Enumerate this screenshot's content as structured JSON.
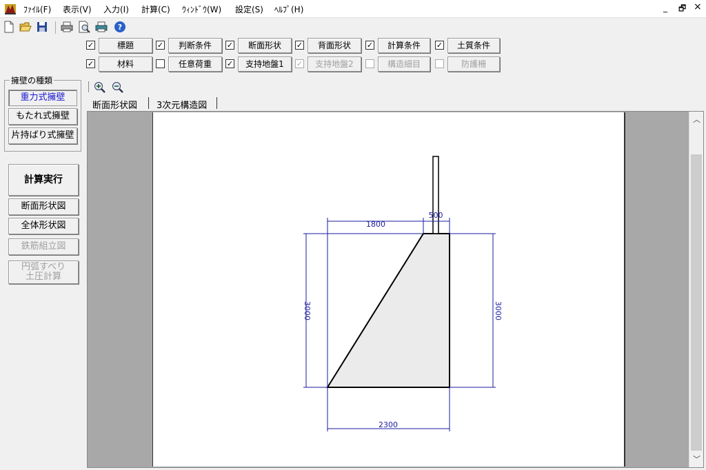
{
  "menu": [
    "ﾌｧｲﾙ(F)",
    "表示(V)",
    "入力(I)",
    "計算(C)",
    "ｳｨﾝﾄﾞｳ(W)",
    "設定(S)",
    "ﾍﾙﾌﾟ(H)"
  ],
  "window_controls": {
    "minimize": "_",
    "restore": "🗗",
    "close": "×"
  },
  "toolbar_icons": [
    "new-file-icon",
    "open-folder-icon",
    "save-icon",
    "print-icon",
    "print-preview-icon",
    "printer-setup-icon",
    "help-icon"
  ],
  "input_row1": [
    {
      "label": "標題",
      "checked": true,
      "enabled": true
    },
    {
      "label": "判断条件",
      "checked": true,
      "enabled": true
    },
    {
      "label": "断面形状",
      "checked": true,
      "enabled": true
    },
    {
      "label": "背面形状",
      "checked": true,
      "enabled": true
    },
    {
      "label": "計算条件",
      "checked": true,
      "enabled": true
    },
    {
      "label": "土質条件",
      "checked": true,
      "enabled": true
    }
  ],
  "input_row2": [
    {
      "label": "材料",
      "checked": true,
      "enabled": true
    },
    {
      "label": "任意荷重",
      "checked": false,
      "enabled": true
    },
    {
      "label": "支持地盤1",
      "checked": true,
      "enabled": true
    },
    {
      "label": "支持地盤2",
      "checked": true,
      "enabled": false
    },
    {
      "label": "構造細目",
      "checked": false,
      "enabled": false
    },
    {
      "label": "防護柵",
      "checked": false,
      "enabled": false
    }
  ],
  "wall_type": {
    "group_label": "擁壁の種類",
    "options": [
      "重力式擁壁",
      "もたれ式擁壁",
      "片持ばり式擁壁"
    ],
    "selected": "重力式擁壁"
  },
  "side_buttons": {
    "calc": "計算実行",
    "section": "断面形状図",
    "overall": "全体形状図",
    "rebar": "鉄筋組立図",
    "slip1": "円弧すべり",
    "slip2": "土圧計算"
  },
  "view_tabs": [
    "断面形状図",
    "3次元構造図"
  ],
  "drawing": {
    "dims": {
      "top_left": "1800",
      "top_right": "500",
      "height_left": "3000",
      "height_right": "3000",
      "bottom": "2300"
    },
    "wall_fill": "#ebebeb",
    "dim_color": "#1a1aa0"
  }
}
